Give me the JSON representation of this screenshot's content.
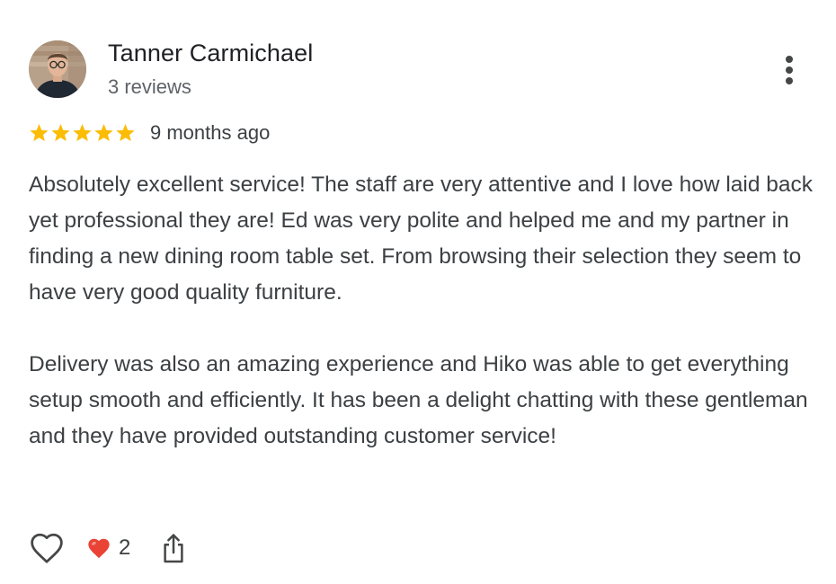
{
  "reviewer": {
    "name": "Tanner Carmichael",
    "meta": "3 reviews",
    "avatar_icon": "profile-photo"
  },
  "rating": {
    "stars": 5,
    "max": 5,
    "star_color": "#fbbc04",
    "date": "9 months ago"
  },
  "review": {
    "paragraphs": [
      "Absolutely excellent service! The staff are very attentive and I love how laid back yet professional they are! Ed was very polite and helped me and my partner in finding a new dining room table set. From browsing their selection they seem to have very good quality furniture.",
      "Delivery was also an amazing experience and Hiko was able to get everything setup smooth and efficiently. It has been a delight chatting with these gentleman and they have provided outstanding customer service!"
    ]
  },
  "actions": {
    "like_icon": "heart-outline-icon",
    "reaction_icon": "red-heart-icon",
    "reaction_color": "#ea4335",
    "reaction_count": "2",
    "share_icon": "share-icon"
  },
  "menu": {
    "icon": "more-vert-icon"
  }
}
